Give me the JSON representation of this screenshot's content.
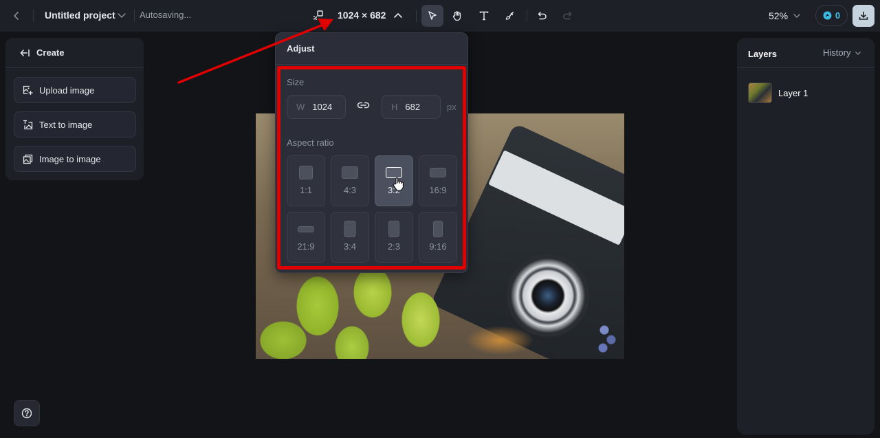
{
  "topbar": {
    "back_icon": "chevron-left-icon",
    "project_title": "Untitled project",
    "project_menu_icon": "chevron-down-icon",
    "save_status": "Autosaving...",
    "resize_icon": "resize-canvas-icon",
    "canvas_size": "1024 × 682",
    "canvas_size_toggle_icon": "chevron-up-icon",
    "tools": [
      {
        "name": "select",
        "icon": "pointer-arrow-icon",
        "active": true
      },
      {
        "name": "pan",
        "icon": "hand-icon",
        "active": false
      },
      {
        "name": "text",
        "icon": "text-t-icon",
        "active": false
      },
      {
        "name": "brush",
        "icon": "brush-icon",
        "active": false
      },
      {
        "name": "undo",
        "icon": "undo-icon",
        "active": false
      },
      {
        "name": "redo",
        "icon": "redo-icon",
        "active": false,
        "disabled": true
      }
    ],
    "zoom_level": "52%",
    "credits": "0",
    "credits_icon": "credit-token-icon",
    "download_icon": "download-icon"
  },
  "left_panel": {
    "header": "Create",
    "header_icon": "collapse-left-icon",
    "buttons": [
      {
        "label": "Upload image",
        "icon": "upload-image-icon"
      },
      {
        "label": "Text to image",
        "icon": "text-to-image-icon"
      },
      {
        "label": "Image to image",
        "icon": "image-to-image-icon"
      }
    ]
  },
  "help": {
    "icon": "help-circle-icon"
  },
  "right_panel": {
    "title": "Layers",
    "history_label": "History",
    "layers": [
      {
        "name": "Layer 1"
      }
    ]
  },
  "adjust_popover": {
    "title": "Adjust",
    "size_label": "Size",
    "width_prefix": "W",
    "width_value": "1024",
    "height_prefix": "H",
    "height_value": "682",
    "unit": "px",
    "link_icon": "link-icon",
    "aspect_label": "Aspect ratio",
    "ratios": [
      {
        "label": "1:1",
        "hovered": false
      },
      {
        "label": "4:3",
        "hovered": false
      },
      {
        "label": "3:2",
        "hovered": true
      },
      {
        "label": "16:9",
        "hovered": false
      },
      {
        "label": "21:9",
        "hovered": false
      },
      {
        "label": "3:4",
        "hovered": false
      },
      {
        "label": "2:3",
        "hovered": false
      },
      {
        "label": "9:16",
        "hovered": false
      }
    ]
  },
  "annotation": {
    "highlight_color": "#e00000",
    "arrow_color": "#e00000"
  },
  "colors": {
    "background": "#131418",
    "panel": "#1e2028",
    "popover": "#2b2e38",
    "accent_credit": "#42c2e6",
    "download_button": "#c4d3de"
  }
}
